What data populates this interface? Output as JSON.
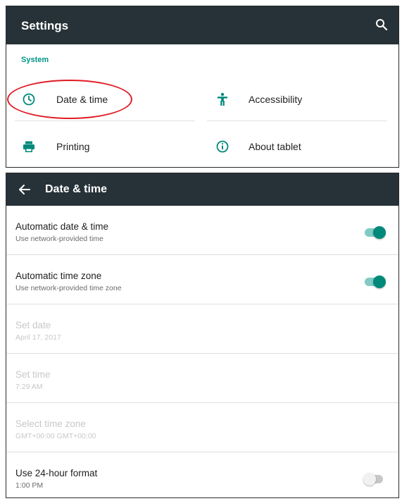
{
  "settings": {
    "title": "Settings",
    "section": "System",
    "tiles": [
      {
        "label": "Date & time",
        "icon": "clock-icon"
      },
      {
        "label": "Accessibility",
        "icon": "accessibility-icon"
      },
      {
        "label": "Printing",
        "icon": "printer-icon"
      },
      {
        "label": "About tablet",
        "icon": "info-icon"
      }
    ]
  },
  "date_time": {
    "title": "Date & time",
    "rows": [
      {
        "title": "Automatic date & time",
        "subtitle": "Use network-provided time",
        "enabled": true,
        "switch": "on"
      },
      {
        "title": "Automatic time zone",
        "subtitle": "Use network-provided time zone",
        "enabled": true,
        "switch": "on"
      },
      {
        "title": "Set date",
        "subtitle": "April 17, 2017",
        "enabled": false
      },
      {
        "title": "Set time",
        "subtitle": "7:29 AM",
        "enabled": false
      },
      {
        "title": "Select time zone",
        "subtitle": "GMT+00:00 GMT+00:00",
        "enabled": false
      },
      {
        "title": "Use 24-hour format",
        "subtitle": "1:00 PM",
        "enabled": true,
        "switch": "off"
      }
    ]
  },
  "colors": {
    "app_bar": "#263238",
    "accent": "#009688",
    "highlight": "#e01b24"
  }
}
